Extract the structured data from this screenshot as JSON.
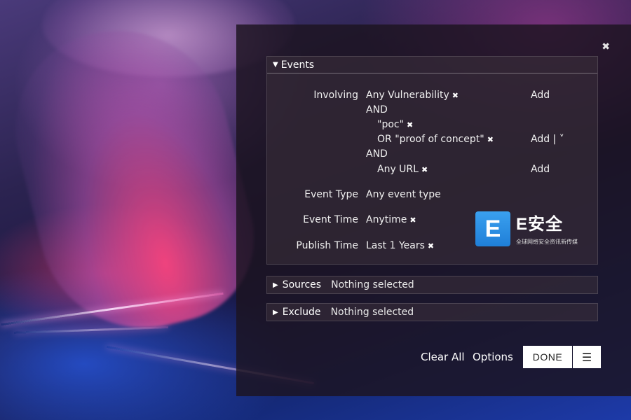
{
  "panel": {
    "close_icon": "✖",
    "events": {
      "header": "Events",
      "involving_label": "Involving",
      "involving_value": "Any Vulnerability",
      "and_1": "AND",
      "poc": "\"poc\"",
      "or_proof": "OR \"proof of concept\"",
      "and_2": "AND",
      "any_url": "Any URL",
      "add_label": "Add",
      "add_more_label": "Add  |  ˅",
      "event_type_label": "Event Type",
      "event_type_value": "Any event type",
      "event_time_label": "Event Time",
      "event_time_value": "Anytime",
      "publish_time_label": "Publish Time",
      "publish_time_value": "Last 1 Years"
    },
    "sources": {
      "header": "Sources",
      "value": "Nothing selected"
    },
    "exclude": {
      "header": "Exclude",
      "value": "Nothing selected"
    },
    "footer": {
      "clear_all": "Clear All",
      "options": "Options",
      "done": "DONE"
    }
  },
  "watermark": {
    "letter": "E",
    "title": "E安全",
    "subtitle": "全球网络安全资讯新传媒"
  },
  "colors": {
    "panel_bg": "#1c1420",
    "logo_blue": "#2b90e6",
    "text": "#ffffff"
  },
  "icons": [
    "close-icon",
    "remove-icon",
    "caret-down-icon",
    "caret-right-icon",
    "list-icon"
  ]
}
